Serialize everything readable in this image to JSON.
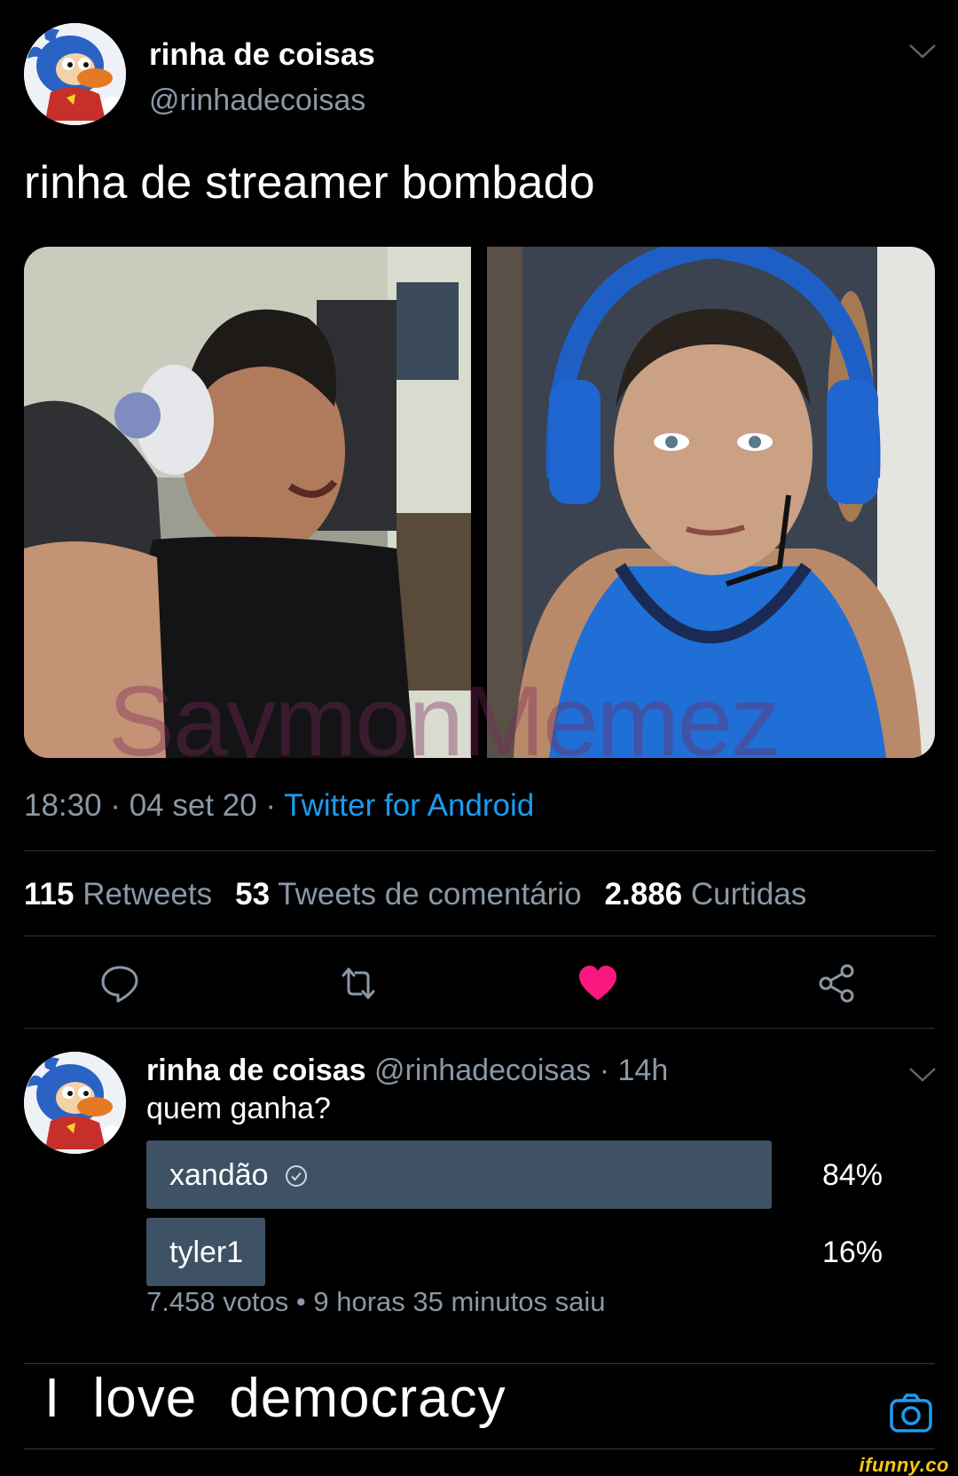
{
  "tweet": {
    "display_name": "rinha de coisas",
    "handle": "@rinhadecoisas",
    "text": "rinha de streamer bombado",
    "watermark": "SaymonMemez",
    "meta_time": "18:30 · 04 set 20 · ",
    "meta_source": "Twitter for Android",
    "stats": {
      "retweets_count": "115",
      "retweets_label": "Retweets",
      "quotes_count": "53",
      "quotes_label": "Tweets de comentário",
      "likes_count": "2.886",
      "likes_label": "Curtidas"
    },
    "actions": [
      "reply-icon",
      "retweet-icon",
      "like-icon",
      "share-icon"
    ],
    "like_color": "#f91880"
  },
  "poll_tweet": {
    "display_name": "rinha de coisas",
    "handle_time": " @rinhadecoisas · 14h",
    "question": "quem ganha?",
    "options": [
      {
        "label": "xandão",
        "percent": "84%",
        "fraction": 0.84,
        "winner": true
      },
      {
        "label": "tyler1",
        "percent": "16%",
        "fraction": 0.16,
        "winner": false
      }
    ],
    "info": "7.458 votos • 9 horas 35 minutos saiu",
    "bar_color": "#3e5165"
  },
  "caption": "I love democracy",
  "brand": "ifunny.co"
}
